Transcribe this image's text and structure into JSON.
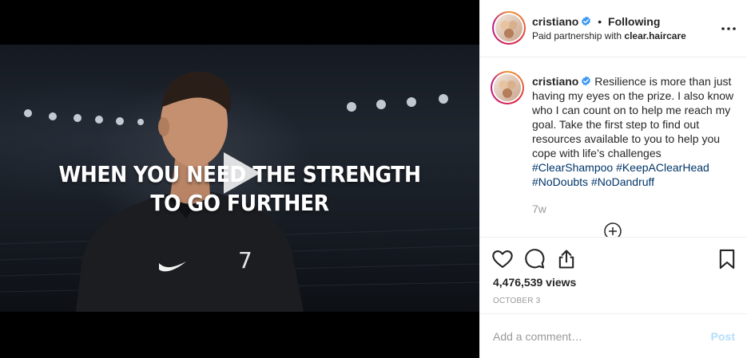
{
  "media": {
    "headline_line1": "WHEN YOU NEED THE STRENGTH",
    "headline_line2": "TO GO FURTHER",
    "jersey_number": "7"
  },
  "header": {
    "username": "cristiano",
    "separator": "•",
    "follow_status": "Following",
    "partnership_prefix": "Paid partnership with",
    "partner_name": "clear.haircare"
  },
  "caption": {
    "username": "cristiano",
    "text": "Resilience is more than just having my eyes on the prize. I also know who I can count on to help me reach my goal. Take the first step to find out resources available to you to help you cope with life’s challenges",
    "hashtags": [
      "#ClearShampoo",
      "#KeepAClearHead",
      "#NoDoubts",
      "#NoDandruff"
    ],
    "time_ago": "7w"
  },
  "stats": {
    "views": "4,476,539 views",
    "date": "OCTOBER 3"
  },
  "comment": {
    "placeholder": "Add a comment…",
    "post_label": "Post"
  },
  "colors": {
    "verified": "#3897f0",
    "hashtag": "#003569",
    "post_disabled": "#b2dffc"
  },
  "icons": [
    "play-icon",
    "verified-icon",
    "more-options-icon",
    "load-more-icon",
    "heart-icon",
    "comment-icon",
    "share-icon",
    "bookmark-icon"
  ]
}
